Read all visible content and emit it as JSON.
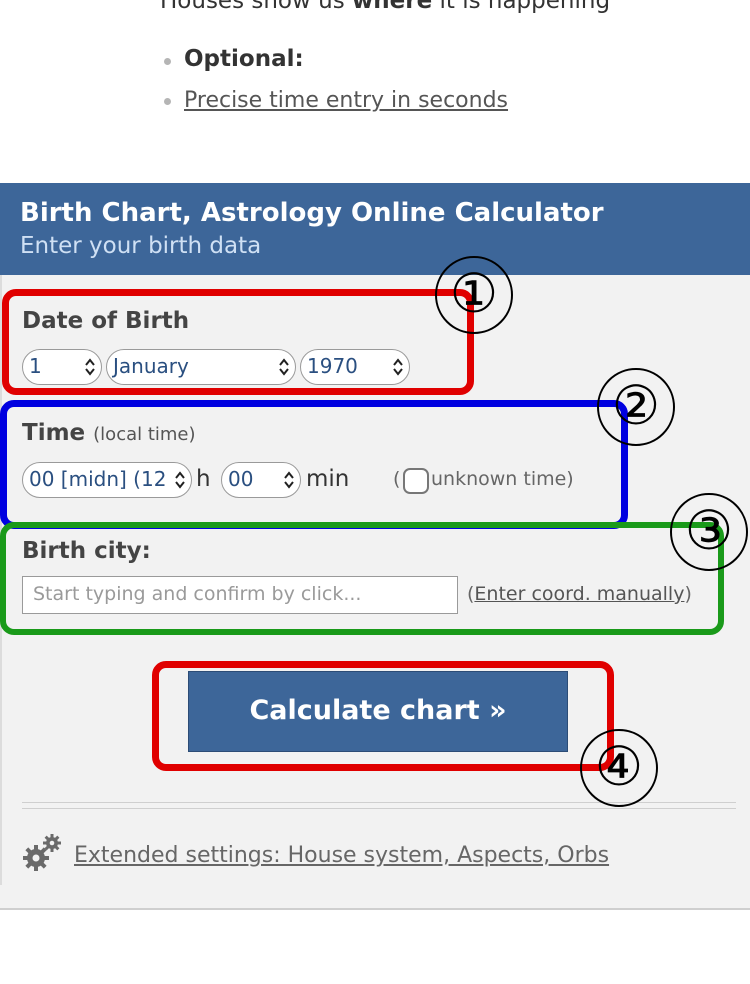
{
  "intro": {
    "line_prefix": "Houses show us ",
    "line_bold": "where",
    "line_suffix": " it is happening",
    "optional_label": "Optional:",
    "precise_link": "Precise time entry in seconds"
  },
  "header": {
    "title": "Birth Chart, Astrology Online Calculator",
    "subtitle": "Enter your birth data"
  },
  "date_section": {
    "label": "Date of Birth",
    "day": "1",
    "month": "January",
    "year": "1970"
  },
  "time_section": {
    "label": "Time",
    "hint": "(local time)",
    "hour": "00 [midn] (12",
    "hour_unit": "h",
    "minute": "00",
    "minute_unit": "min",
    "unknown_open": "(",
    "unknown_label": "unknown time)"
  },
  "city_section": {
    "label": "Birth city:",
    "placeholder": "Start typing and confirm by click...",
    "coord_open": "(",
    "coord_link": "Enter coord. manually",
    "coord_close": ")"
  },
  "actions": {
    "calculate": "Calculate chart »"
  },
  "extended": {
    "link": "Extended settings: House system, Aspects, Orbs"
  },
  "annotations": {
    "one": "①",
    "two": "②",
    "three": "③",
    "four": "④"
  },
  "colors": {
    "header_bg": "#3d6699",
    "box_red": "#e00000",
    "box_blue": "#0000e0",
    "box_green": "#1a9a1a"
  }
}
